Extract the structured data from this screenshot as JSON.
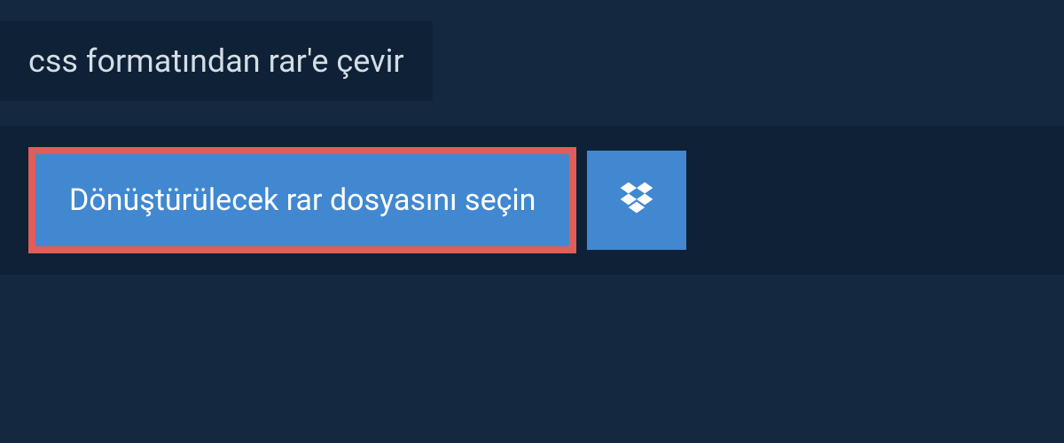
{
  "header": {
    "title": "css formatından rar'e çevir"
  },
  "main": {
    "select_file_label": "Dönüştürülecek rar dosyasını seçin"
  },
  "colors": {
    "page_bg": "#14293f",
    "panel_bg": "#0e2136",
    "button_bg": "#4188d0",
    "button_border": "#e15d59",
    "text_light": "#d5dde5",
    "text_white": "#ffffff"
  }
}
